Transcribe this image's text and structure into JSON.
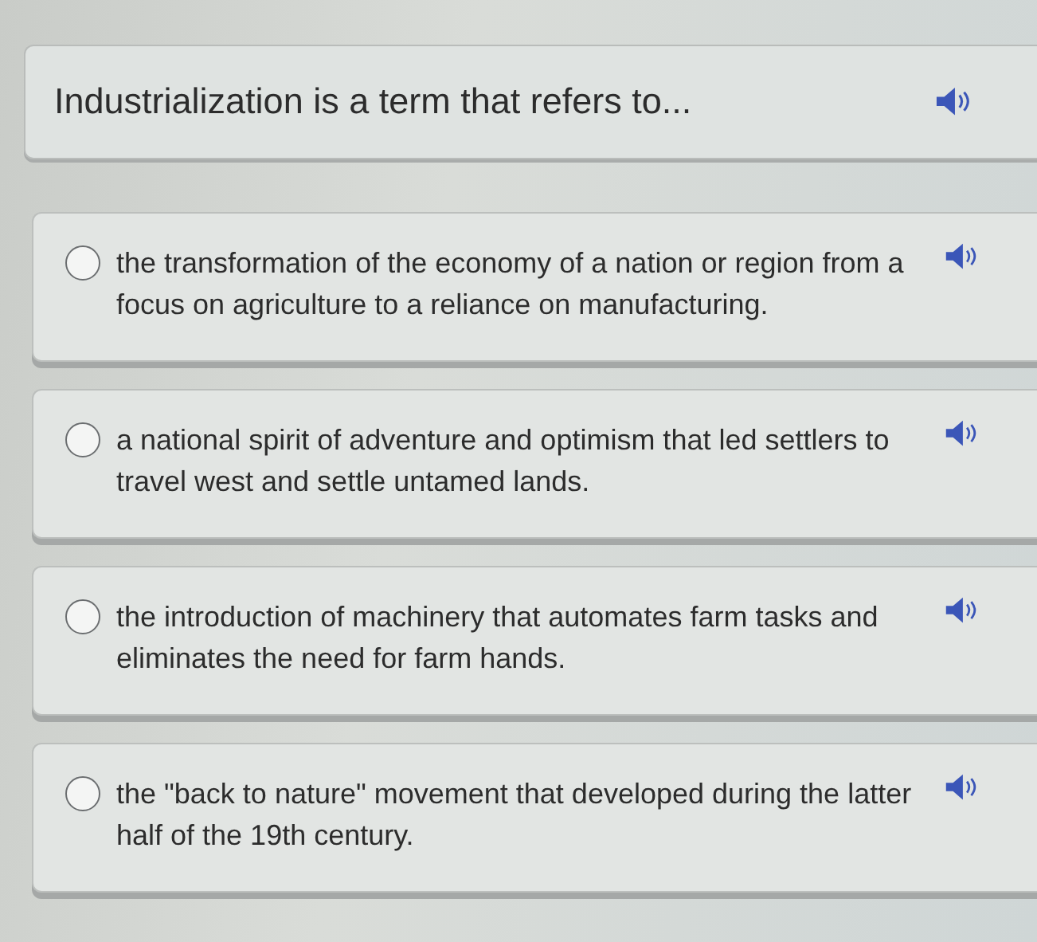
{
  "question": {
    "text": "Industrialization is a term that refers to..."
  },
  "answers": [
    {
      "text": "the transformation of the economy of a nation or region from a focus on agriculture to a reliance on manufacturing.",
      "selected": false
    },
    {
      "text": "a national spirit of adventure and optimism that led settlers to travel west and settle untamed lands.",
      "selected": false
    },
    {
      "text": "the introduction of machinery that automates farm tasks and eliminates the need for farm hands.",
      "selected": false
    },
    {
      "text": "the \"back to nature\" movement that developed during the latter half of the 19th century.",
      "selected": false
    }
  ]
}
